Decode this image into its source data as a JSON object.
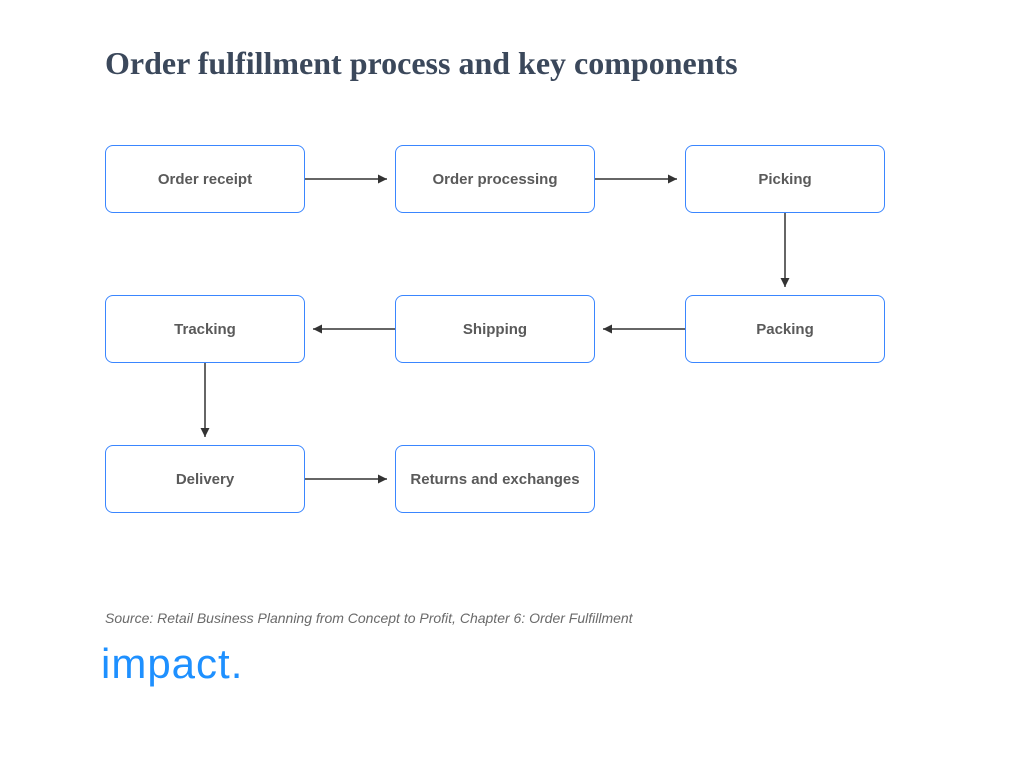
{
  "title": "Order fulfillment process and key components",
  "nodes": {
    "n1": "Order receipt",
    "n2": "Order processing",
    "n3": "Picking",
    "n4": "Packing",
    "n5": "Shipping",
    "n6": "Tracking",
    "n7": "Delivery",
    "n8": "Returns and exchanges"
  },
  "edges": [
    [
      "n1",
      "n2"
    ],
    [
      "n2",
      "n3"
    ],
    [
      "n3",
      "n4"
    ],
    [
      "n4",
      "n5"
    ],
    [
      "n5",
      "n6"
    ],
    [
      "n6",
      "n7"
    ],
    [
      "n7",
      "n8"
    ]
  ],
  "source_note": "Source: Retail Business Planning from Concept to Profit, Chapter 6: Order Fulfillment",
  "logo_text": "impact."
}
